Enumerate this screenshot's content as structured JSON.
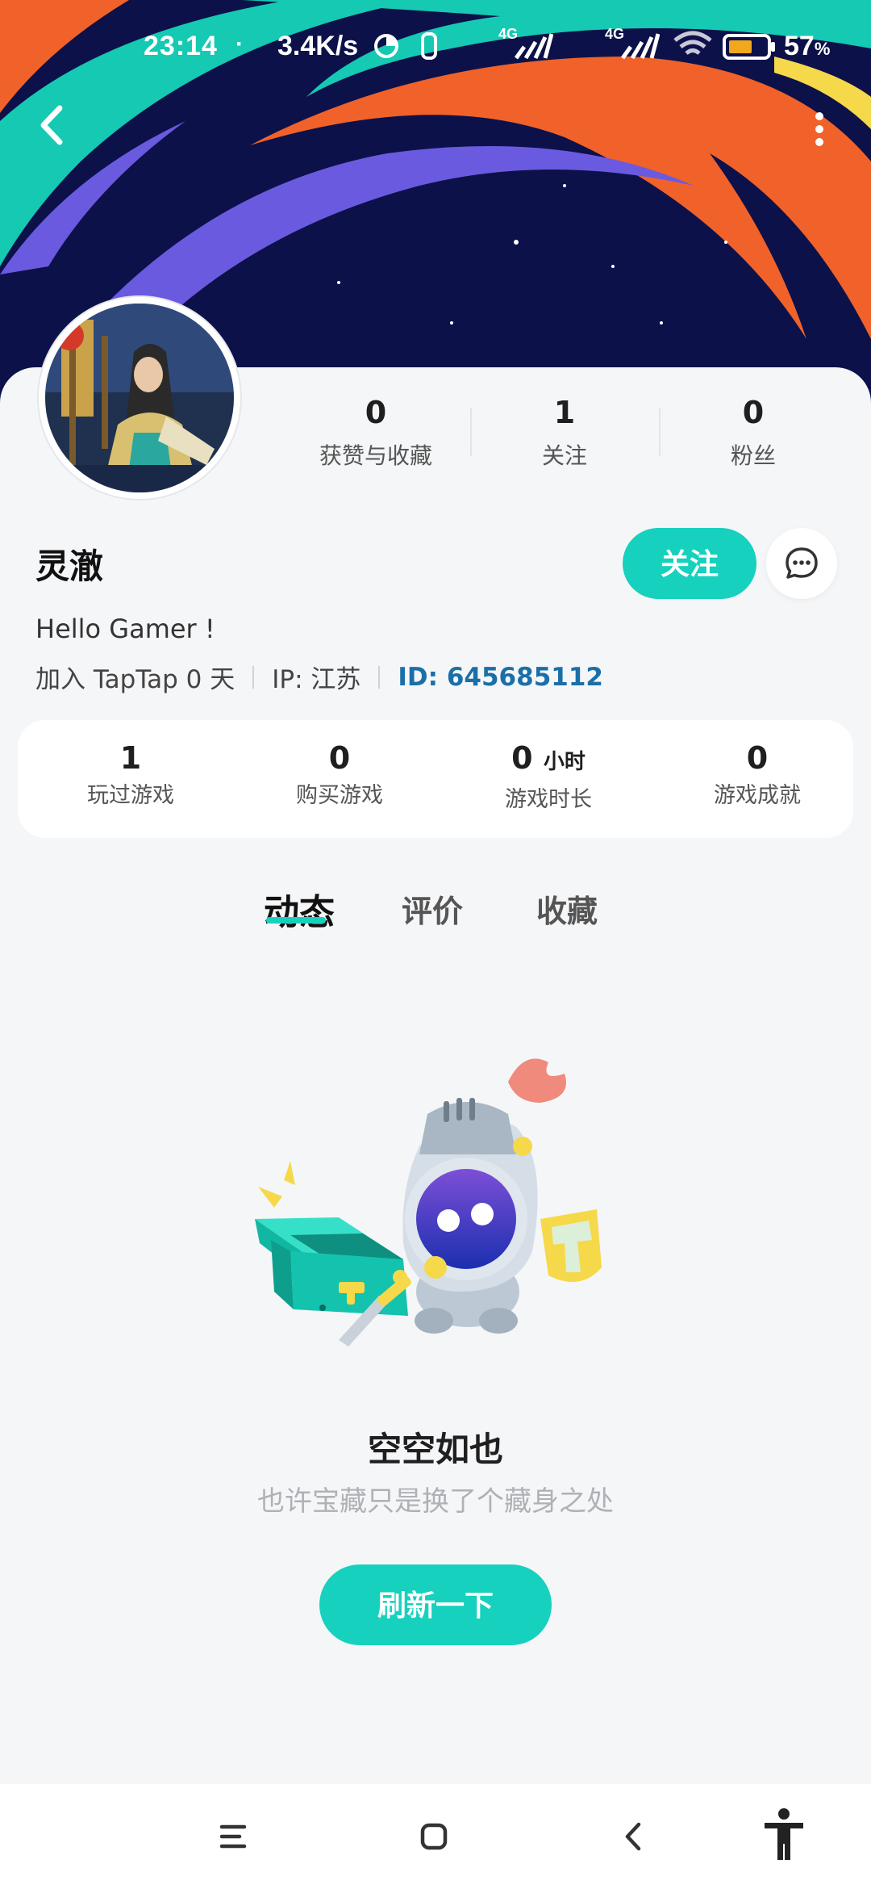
{
  "status_bar": {
    "time": "23:14",
    "separator": "·",
    "net_speed": "3.4K/s",
    "signal_1": "4G",
    "signal_2": "4G",
    "battery_level": "57",
    "battery_sign": "%"
  },
  "profile": {
    "username": "灵澈",
    "bio": "Hello Gamer !",
    "joined": "加入 TapTap 0 天",
    "ip": "IP: 江苏",
    "id": "ID: 645685112",
    "follow_label": "关注",
    "message_icon": "chat-bubble-icon"
  },
  "social_stats": [
    {
      "value": "0",
      "label": "获赞与收藏"
    },
    {
      "value": "1",
      "label": "关注"
    },
    {
      "value": "0",
      "label": "粉丝"
    }
  ],
  "game_stats": [
    {
      "value": "1",
      "unit": "",
      "label": "玩过游戏"
    },
    {
      "value": "0",
      "unit": "",
      "label": "购买游戏"
    },
    {
      "value": "0",
      "unit": "小时",
      "label": "游戏时长"
    },
    {
      "value": "0",
      "unit": "",
      "label": "游戏成就"
    }
  ],
  "tabs": [
    {
      "label": "动态",
      "active": true
    },
    {
      "label": "评价",
      "active": false
    },
    {
      "label": "收藏",
      "active": false
    }
  ],
  "empty_state": {
    "title": "空空如也",
    "subtitle": "也许宝藏只是换了个藏身之处",
    "refresh_label": "刷新一下"
  },
  "colors": {
    "accent": "#16d1bd",
    "id_blue": "#1a6fa8",
    "banner_bg": "#0d1149",
    "banner_orange": "#f0622a",
    "banner_teal": "#15c9b3",
    "banner_purple": "#6a5ae0"
  }
}
